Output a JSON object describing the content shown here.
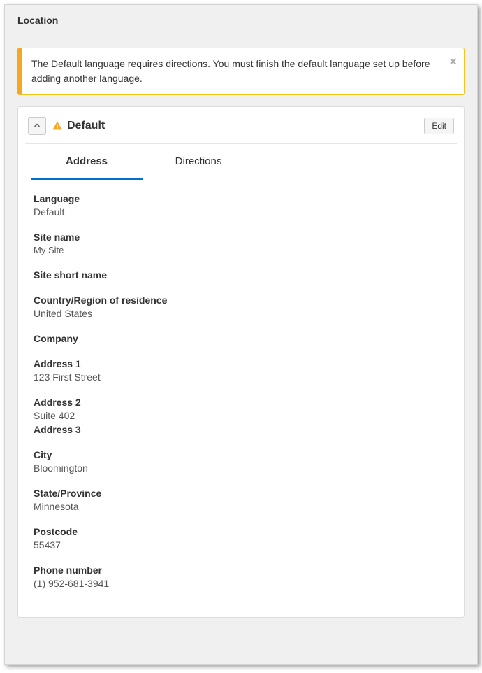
{
  "header": {
    "title": "Location"
  },
  "alert": {
    "message": "The Default language requires directions. You must finish the default language set up before adding another language."
  },
  "card": {
    "title": "Default",
    "edit_label": "Edit"
  },
  "tabs": {
    "address": "Address",
    "directions": "Directions"
  },
  "fields": {
    "language": {
      "label": "Language",
      "value": "Default"
    },
    "site_name": {
      "label": "Site name",
      "value": "My Site"
    },
    "site_short_name": {
      "label": "Site short name",
      "value": ""
    },
    "country": {
      "label": "Country/Region of residence",
      "value": "United States"
    },
    "company": {
      "label": "Company",
      "value": ""
    },
    "address1": {
      "label": "Address 1",
      "value": "123 First Street"
    },
    "address2": {
      "label": "Address 2",
      "value": "Suite 402"
    },
    "address3": {
      "label": "Address 3",
      "value": ""
    },
    "city": {
      "label": "City",
      "value": "Bloomington"
    },
    "state": {
      "label": "State/Province",
      "value": "Minnesota"
    },
    "postcode": {
      "label": "Postcode",
      "value": "55437"
    },
    "phone": {
      "label": "Phone number",
      "value": "(1) 952-681-3941"
    }
  }
}
